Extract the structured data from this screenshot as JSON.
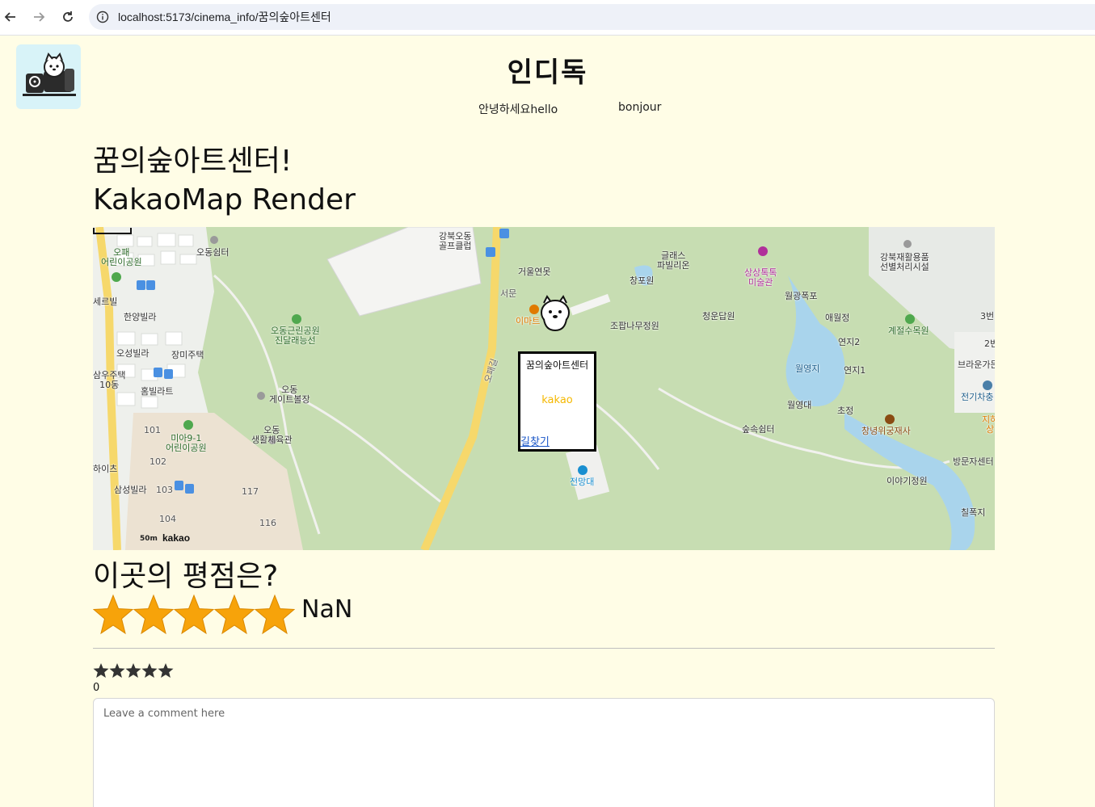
{
  "browser": {
    "url": "localhost:5173/cinema_info/꿈의숲아트센터"
  },
  "header": {
    "title": "인디독",
    "nav": [
      "안녕하세요hello",
      "bonjour"
    ]
  },
  "page": {
    "cinema_heading": "꿈의숲아트센터!",
    "map_heading": "KakaoMap Render",
    "rating_heading": "이곳의 평점은?",
    "rating_value": "NaN",
    "rating_count": "0",
    "comment_placeholder": "Leave a comment here"
  },
  "map": {
    "info_window": {
      "title": "꿈의숲아트센터",
      "brand": "kakao",
      "link": "길찾기"
    },
    "scale_label": "50m",
    "brand": "kakao",
    "labels": [
      {
        "text": "오패\n어린이공원",
        "color": "#2d6b2a"
      },
      {
        "text": "오동쉼터",
        "color": "#333"
      },
      {
        "text": "강북오동\n골프클럽",
        "color": "#333"
      },
      {
        "text": "거울연못",
        "color": "#333"
      },
      {
        "text": "서문",
        "color": "#555"
      },
      {
        "text": "이마트",
        "color": "#e07a00"
      },
      {
        "text": "한양빌라",
        "color": "#333"
      },
      {
        "text": "세르빌",
        "color": "#333"
      },
      {
        "text": "오동근린공원\n진달래능선",
        "color": "#2d6b2a"
      },
      {
        "text": "오성빌라",
        "color": "#333"
      },
      {
        "text": "장미주택",
        "color": "#333"
      },
      {
        "text": "삼우주택\n10동",
        "color": "#333"
      },
      {
        "text": "홈빌라트",
        "color": "#333"
      },
      {
        "text": "오동\n게이트볼장",
        "color": "#333"
      },
      {
        "text": "오동\n생활체육관",
        "color": "#333"
      },
      {
        "text": "미아9-1\n어린이공원",
        "color": "#2d6b2a"
      },
      {
        "text": "하이츠",
        "color": "#333"
      },
      {
        "text": "삼성빌라",
        "color": "#333"
      },
      {
        "text": "101",
        "color": "#555"
      },
      {
        "text": "102",
        "color": "#555"
      },
      {
        "text": "103",
        "color": "#555"
      },
      {
        "text": "104",
        "color": "#555"
      },
      {
        "text": "117",
        "color": "#555"
      },
      {
        "text": "116",
        "color": "#555"
      },
      {
        "text": "글래스\n파빌리온",
        "color": "#333"
      },
      {
        "text": "창포원",
        "color": "#333"
      },
      {
        "text": "상상톡톡\n미술관",
        "color": "#b0309a"
      },
      {
        "text": "조팝나무정원",
        "color": "#333"
      },
      {
        "text": "청운답원",
        "color": "#333"
      },
      {
        "text": "월광폭포",
        "color": "#333"
      },
      {
        "text": "애월정",
        "color": "#333"
      },
      {
        "text": "연지2",
        "color": "#333"
      },
      {
        "text": "월영지",
        "color": "#1f5f8c"
      },
      {
        "text": "연지1",
        "color": "#333"
      },
      {
        "text": "월영대",
        "color": "#333"
      },
      {
        "text": "초정",
        "color": "#333"
      },
      {
        "text": "숲속쉼터",
        "color": "#333"
      },
      {
        "text": "전망대",
        "color": "#1a8fd0"
      },
      {
        "text": "강북재활용품\n선별처리시설",
        "color": "#333"
      },
      {
        "text": "계절수목원",
        "color": "#2d6b2a"
      },
      {
        "text": "창녕위궁재사",
        "color": "#8a4b12"
      },
      {
        "text": "브라운가든",
        "color": "#333"
      },
      {
        "text": "전기차충",
        "color": "#1f5f8c"
      },
      {
        "text": "방문자센터",
        "color": "#333"
      },
      {
        "text": "이야기정원",
        "color": "#333"
      },
      {
        "text": "칠폭지",
        "color": "#333"
      },
      {
        "text": "3번",
        "color": "#333"
      },
      {
        "text": "2번",
        "color": "#333"
      },
      {
        "text": "지하\n상",
        "color": "#e07a00"
      },
      {
        "text": "오패길",
        "color": "#666"
      }
    ]
  },
  "colors": {
    "background": "#fffde6",
    "star": "#f7a30a",
    "star_small": "#333333",
    "link": "#1a56c7"
  },
  "rating": {
    "big_stars": 5,
    "small_stars": 5
  }
}
